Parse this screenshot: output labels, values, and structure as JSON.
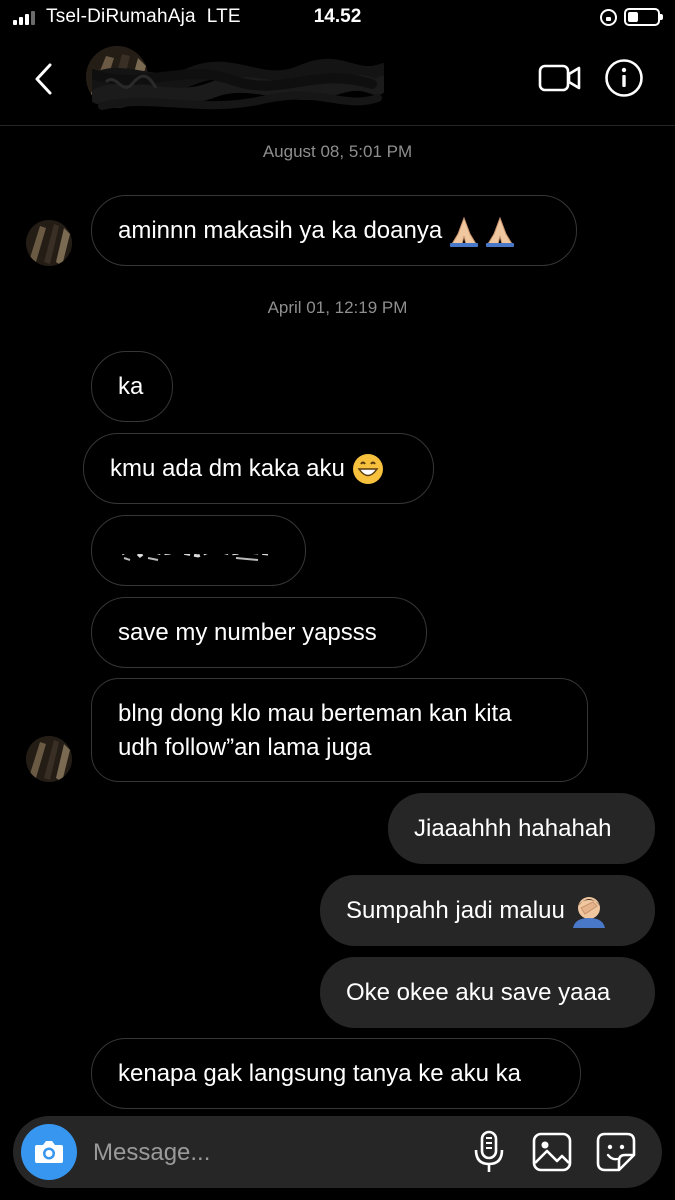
{
  "status_bar": {
    "carrier": "Tsel-DiRumahAja",
    "network": "LTE",
    "time": "14.52"
  },
  "header": {
    "contact_name_redacted": true
  },
  "messages": {
    "ts1": "August 08, 5:01 PM",
    "m1": "aminnn makasih ya ka doanya",
    "ts2": "April 01, 12:19 PM",
    "m2": "ka",
    "m3": "kmu ada dm kaka aku",
    "m5": "save my number yapsss",
    "m6_line1": "blng dong klo mau berteman kan kita",
    "m6_line2": "udh follow”an lama juga",
    "s1": "Jiaaahhh hahahah",
    "s2": "Sumpahh jadi maluu",
    "s3": "Oke okee aku save yaaa",
    "m7": "kenapa gak langsung tanya ke aku ka"
  },
  "composer": {
    "placeholder": "Message..."
  },
  "icons": {
    "back": "chevron-left-icon",
    "video": "video-camera-icon",
    "info": "info-icon",
    "camera": "camera-icon",
    "mic": "microphone-icon",
    "gallery": "image-icon",
    "sticker": "sticker-icon"
  },
  "colors": {
    "background": "#000000",
    "sent_bubble": "#262626",
    "received_border": "#363636",
    "timestamp": "#8e8e8e",
    "camera_button": "#3797f0"
  }
}
